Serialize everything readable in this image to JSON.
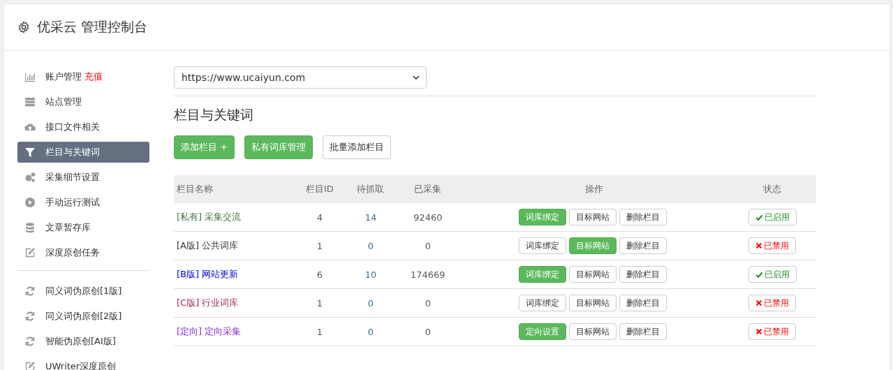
{
  "header": {
    "title": "优采云 管理控制台"
  },
  "sidebar": {
    "groups": [
      [
        {
          "label": "账户管理",
          "badge": "充值",
          "selected": false
        },
        {
          "label": "站点管理",
          "selected": false
        },
        {
          "label": "接口文件相关",
          "selected": false
        },
        {
          "label": "栏目与关键词",
          "selected": true
        },
        {
          "label": "采集细节设置",
          "selected": false
        },
        {
          "label": "手动运行测试",
          "selected": false
        },
        {
          "label": "文章暂存库",
          "selected": false
        },
        {
          "label": "深度原创任务",
          "selected": false
        }
      ],
      [
        {
          "label": "同义词伪原创[1版]",
          "selected": false
        },
        {
          "label": "同义词伪原创[2版]",
          "selected": false
        },
        {
          "label": "智能伪原创[AI版]",
          "selected": false
        },
        {
          "label": "UWriter深度原创",
          "selected": false
        }
      ]
    ]
  },
  "site_select": {
    "value": "https://www.ucaiyun.com"
  },
  "section_title": "栏目与关键词",
  "toolbar": [
    {
      "label": "添加栏目 +",
      "kind": "primary"
    },
    {
      "label": "私有词库管理",
      "kind": "primary"
    },
    {
      "label": "批量添加栏目",
      "kind": "default"
    }
  ],
  "table": {
    "columns": [
      "栏目名称",
      "栏目ID",
      "待抓取",
      "已采集",
      "操作",
      "状态"
    ],
    "rows": [
      {
        "name": "[私有] 采集交流",
        "color": "#3c763d",
        "id": "4",
        "pending": "14",
        "collected": "92460",
        "actions": [
          {
            "label": "词库绑定",
            "highlighted": true
          },
          {
            "label": "目标网站",
            "highlighted": false
          },
          {
            "label": "删除栏目",
            "highlighted": false
          }
        ],
        "status": "已启用",
        "enabled": true
      },
      {
        "name": "[A版] 公共词库",
        "color": "#333333",
        "id": "1",
        "pending": "0",
        "collected": "0",
        "actions": [
          {
            "label": "词库绑定",
            "highlighted": false
          },
          {
            "label": "目标网站",
            "highlighted": true
          },
          {
            "label": "删除栏目",
            "highlighted": false
          }
        ],
        "status": "已禁用",
        "enabled": false
      },
      {
        "name": "[B版] 网站更新",
        "color": "#0000ee",
        "id": "6",
        "pending": "10",
        "collected": "174669",
        "actions": [
          {
            "label": "词库绑定",
            "highlighted": true
          },
          {
            "label": "目标网站",
            "highlighted": false
          },
          {
            "label": "删除栏目",
            "highlighted": false
          }
        ],
        "status": "已启用",
        "enabled": true
      },
      {
        "name": "[C版] 行业词库",
        "color": "#a52a4a",
        "id": "1",
        "pending": "0",
        "collected": "0",
        "actions": [
          {
            "label": "词库绑定",
            "highlighted": false
          },
          {
            "label": "目标网站",
            "highlighted": false
          },
          {
            "label": "删除栏目",
            "highlighted": false
          }
        ],
        "status": "已禁用",
        "enabled": false
      },
      {
        "name": "[定向] 定向采集",
        "color": "#8a2be2",
        "id": "1",
        "pending": "0",
        "collected": "0",
        "actions": [
          {
            "label": "定向设置",
            "highlighted": true
          },
          {
            "label": "目标网站",
            "highlighted": false
          },
          {
            "label": "删除栏目",
            "highlighted": false
          }
        ],
        "status": "已禁用",
        "enabled": false
      }
    ]
  }
}
